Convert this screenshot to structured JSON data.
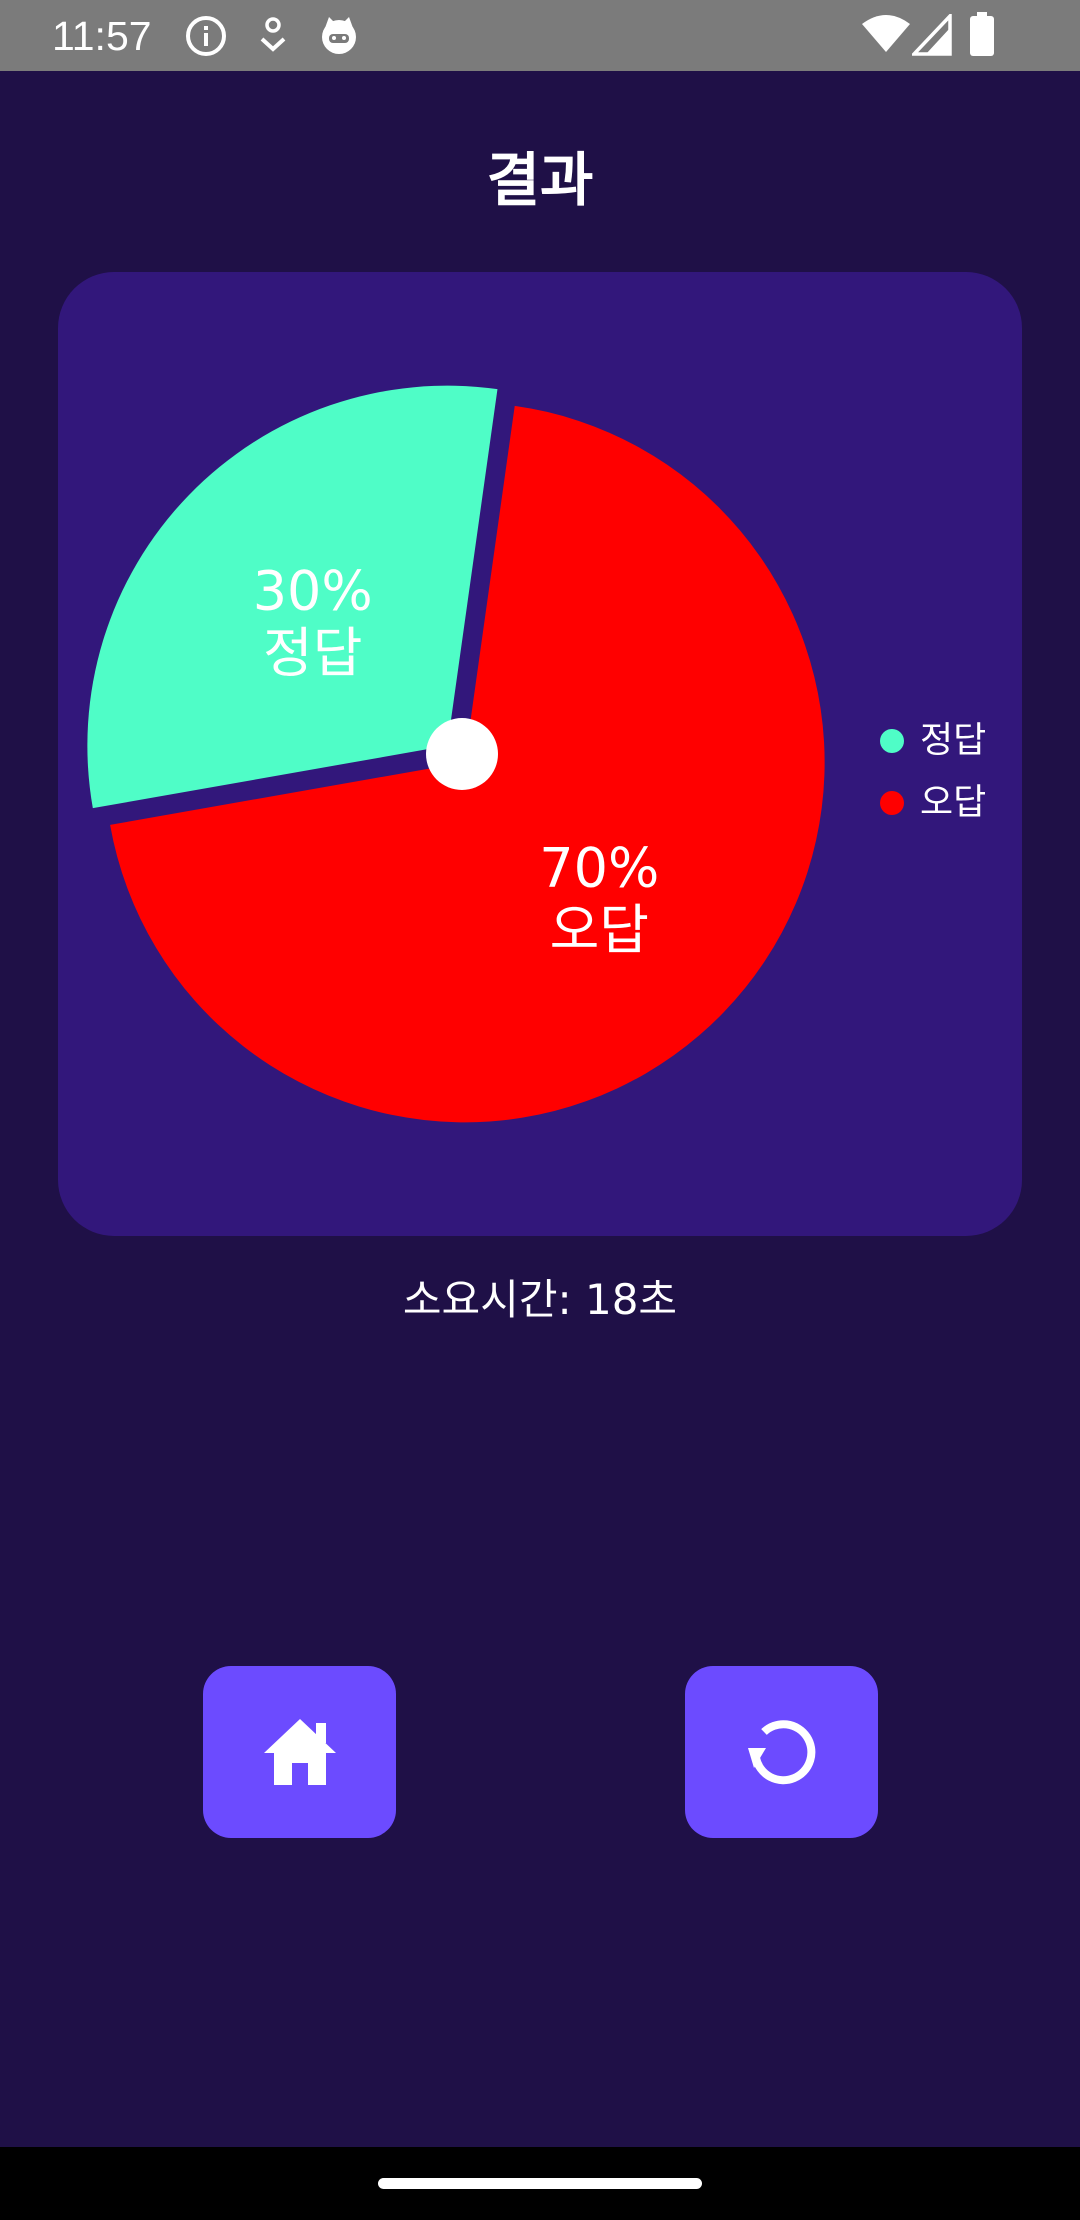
{
  "status_bar": {
    "time": "11:57",
    "left_icons": [
      "info-icon",
      "download-badge-icon",
      "cat-face-icon"
    ],
    "right_icons": [
      "wifi-icon",
      "cell-signal-icon",
      "battery-icon"
    ]
  },
  "header": {
    "title": "결과"
  },
  "chart_data": {
    "type": "pie",
    "slices": [
      {
        "label": "정답",
        "value": 30,
        "color": "#4ffdc7",
        "text": "30%",
        "name_text": "정답"
      },
      {
        "label": "오답",
        "value": 70,
        "color": "#ff0000",
        "text": "70%",
        "name_text": "오답"
      }
    ],
    "legend": {
      "position": "right",
      "items": [
        {
          "label": "정답",
          "color": "#4ffdc7"
        },
        {
          "label": "오답",
          "color": "#ff0000"
        }
      ]
    },
    "center_hole": true
  },
  "elapsed": {
    "text": "소요시간: 18초"
  },
  "actions": {
    "home_icon": "home-icon",
    "replay_icon": "replay-icon"
  },
  "colors": {
    "background": "#1f1047",
    "card": "#32177b",
    "button": "#6c4bff",
    "correct": "#4ffdc7",
    "wrong": "#ff0000"
  }
}
